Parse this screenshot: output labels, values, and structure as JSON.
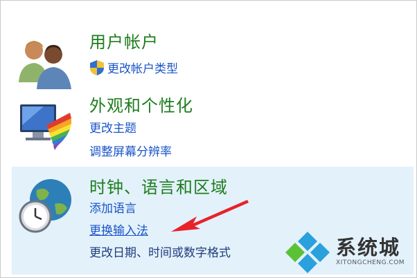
{
  "categories": {
    "users": {
      "title": "用户帐户",
      "icon": "users-icon",
      "links": [
        "更改帐户类型"
      ]
    },
    "appearance": {
      "title": "外观和个性化",
      "icon": "monitor-palette-icon",
      "links": [
        "更改主题",
        "调整屏幕分辨率"
      ]
    },
    "clock": {
      "title": "时钟、语言和区域",
      "icon": "clock-globe-icon",
      "links": [
        "添加语言",
        "更换输入法",
        "更改日期、时间或数字格式"
      ]
    }
  },
  "colors": {
    "title_green": "#1e7d1e",
    "link_blue": "#1a55c8",
    "highlight_bg": "#e3f1fb",
    "arrow_red": "#e8222a"
  },
  "watermark": {
    "name": "系统城",
    "site": "XITONGCHENG.COM",
    "icon": "diamond-logo-icon"
  }
}
